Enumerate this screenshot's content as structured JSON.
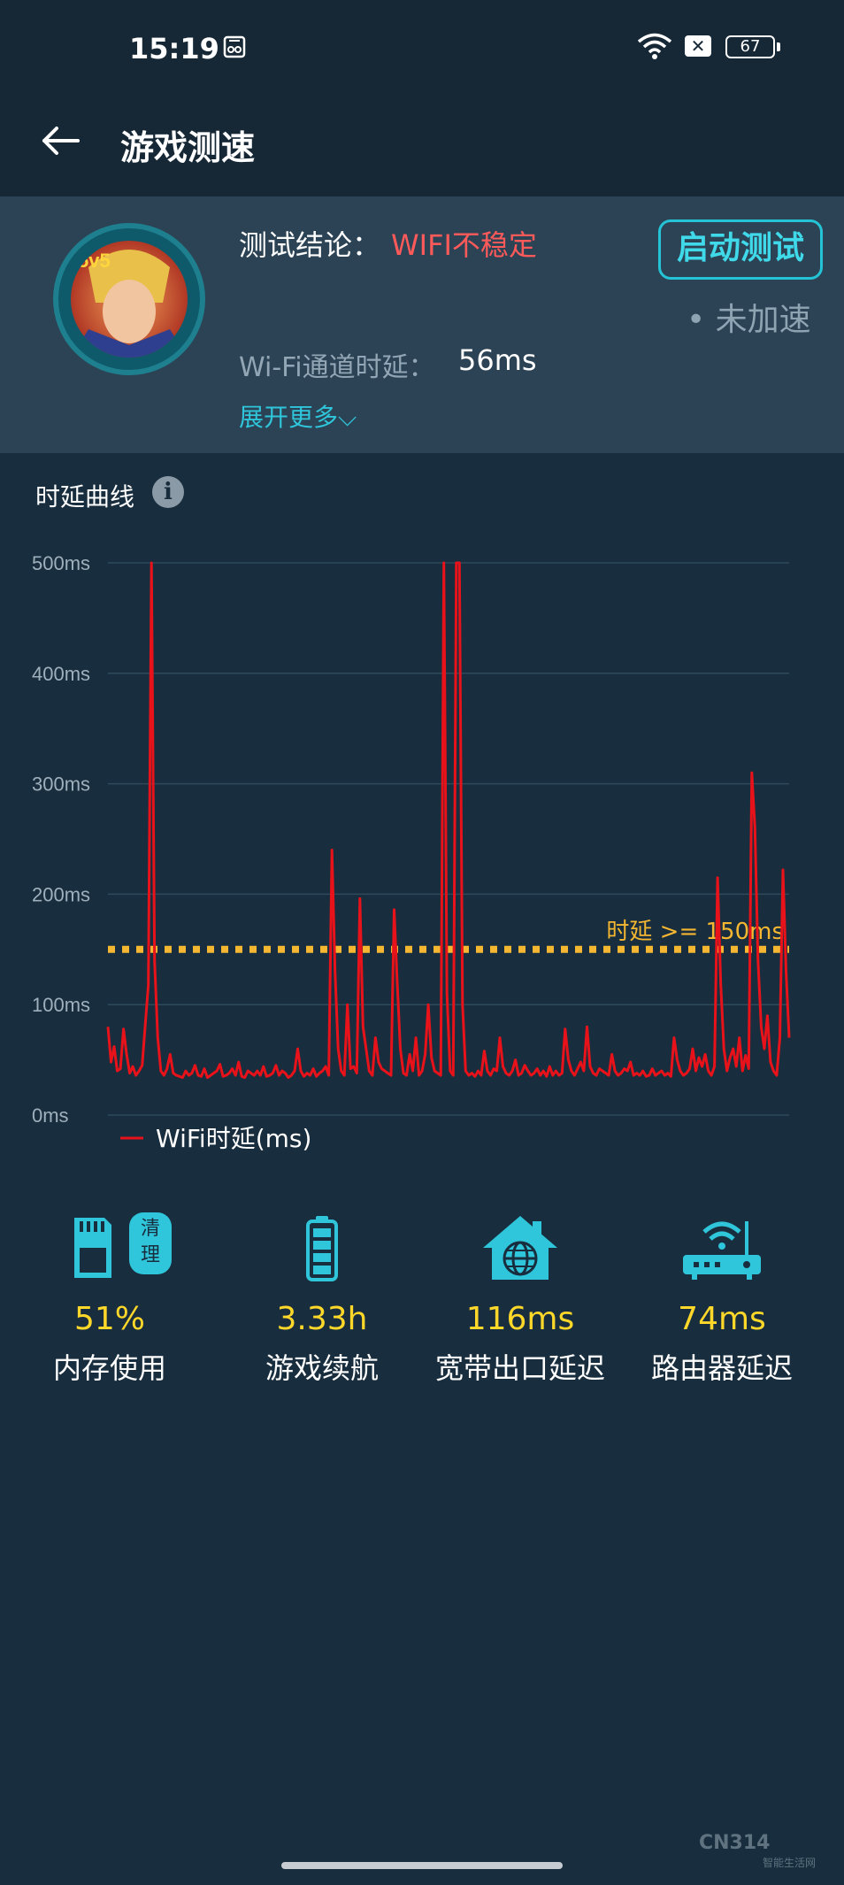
{
  "status_bar": {
    "time": "15:19",
    "battery": "67"
  },
  "header": {
    "title": "游戏测速"
  },
  "summary": {
    "conclusion_label": "测试结论：",
    "conclusion_value": "WIFI不稳定",
    "start_button": "启动测试",
    "accel_status": "• 未加速",
    "delay_label": "Wi-Fi通道时延：",
    "delay_value": "56ms",
    "expand_link": "展开更多⌵"
  },
  "chart_section": {
    "title": "时延曲线"
  },
  "chart_data": {
    "type": "line",
    "title": "",
    "xlabel": "",
    "ylabel": "",
    "ylim": [
      0,
      500
    ],
    "yticks": [
      "0ms",
      "100ms",
      "200ms",
      "300ms",
      "400ms",
      "500ms"
    ],
    "threshold": {
      "value": 150,
      "label": "时延 >= 150ms",
      "color": "#f5b731"
    },
    "legend": {
      "position": "bottom-left"
    },
    "grid": true,
    "series": [
      {
        "name": "WiFi时延(ms)",
        "color": "#e8121a",
        "values": [
          80,
          48,
          62,
          40,
          42,
          78,
          55,
          38,
          44,
          36,
          40,
          45,
          82,
          118,
          500,
          140,
          70,
          40,
          36,
          42,
          55,
          38,
          36,
          35,
          34,
          40,
          36,
          38,
          45,
          36,
          35,
          42,
          34,
          36,
          38,
          40,
          46,
          35,
          36,
          38,
          42,
          36,
          48,
          35,
          34,
          40,
          38,
          36,
          40,
          36,
          44,
          35,
          36,
          38,
          45,
          36,
          40,
          38,
          34,
          36,
          40,
          60,
          40,
          35,
          38,
          36,
          42,
          35,
          38,
          40,
          44,
          36,
          240,
          130,
          60,
          40,
          36,
          100,
          42,
          44,
          38,
          196,
          80,
          60,
          40,
          36,
          70,
          48,
          42,
          40,
          38,
          36,
          186,
          120,
          60,
          38,
          36,
          55,
          40,
          70,
          36,
          40,
          55,
          100,
          52,
          40,
          38,
          36,
          500,
          110,
          40,
          36,
          500,
          500,
          100,
          40,
          36,
          38,
          35,
          40,
          36,
          58,
          40,
          36,
          42,
          40,
          70,
          44,
          38,
          36,
          40,
          50,
          36,
          38,
          45,
          40,
          36,
          38,
          42,
          36,
          40,
          35,
          44,
          36,
          40,
          36,
          38,
          78,
          50,
          40,
          36,
          42,
          48,
          40,
          80,
          44,
          38,
          36,
          42,
          40,
          38,
          36,
          55,
          40,
          36,
          38,
          42,
          40,
          48,
          36,
          38,
          36,
          40,
          35,
          36,
          42,
          36,
          38,
          40,
          36,
          38,
          35,
          70,
          50,
          40,
          36,
          38,
          42,
          60,
          40,
          52,
          44,
          55,
          40,
          36,
          44,
          215,
          120,
          60,
          40,
          52,
          60,
          44,
          70,
          40,
          54,
          42,
          310,
          260,
          140,
          80,
          60,
          90,
          48,
          40,
          36,
          70,
          222,
          130,
          70
        ]
      }
    ]
  },
  "stats": [
    {
      "value": "51%",
      "label": "内存使用",
      "icon": "sd-card-icon",
      "badge": "清理"
    },
    {
      "value": "3.33h",
      "label": "游戏续航",
      "icon": "battery-icon"
    },
    {
      "value": "116ms",
      "label": "宽带出口延迟",
      "icon": "home-globe-icon"
    },
    {
      "value": "74ms",
      "label": "路由器延迟",
      "icon": "router-icon"
    }
  ],
  "watermark": {
    "brand": "CN314",
    "sub": "智能生活网"
  },
  "colors": {
    "accent": "#2fc5da",
    "warning": "#ff5a5a",
    "stat_value": "#ffd82a",
    "background": "#182d3d"
  }
}
